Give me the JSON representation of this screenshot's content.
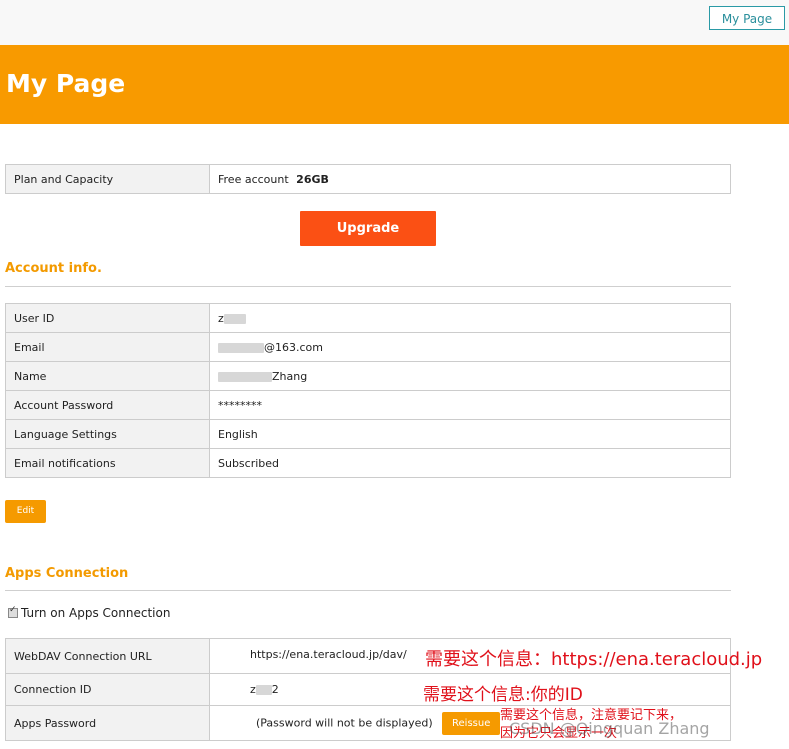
{
  "header": {
    "mypage_button": "My Page",
    "title": "My Page"
  },
  "plan": {
    "label": "Plan and Capacity",
    "value_prefix": "Free account",
    "capacity": "26GB",
    "upgrade_button": "Upgrade"
  },
  "account": {
    "title": "Account info.",
    "rows": [
      {
        "label": "User ID",
        "value": "z"
      },
      {
        "label": "Email",
        "value": "@163.com"
      },
      {
        "label": "Name",
        "value": "Zhang"
      },
      {
        "label": "Account Password",
        "value": "********"
      },
      {
        "label": "Language Settings",
        "value": "English"
      },
      {
        "label": "Email notifications",
        "value": "Subscribed"
      }
    ],
    "edit_button": "Edit"
  },
  "apps": {
    "title": "Apps Connection",
    "toggle_label": "Turn on Apps Connection",
    "rows": [
      {
        "label": "WebDAV Connection URL",
        "value": "https://ena.teracloud.jp/dav/"
      },
      {
        "label": "Connection ID",
        "value": "z",
        "value_suffix": "2"
      },
      {
        "label": "Apps Password",
        "value": "(Password will not be displayed)"
      }
    ],
    "reissue_button": "Reissue"
  },
  "annotations": {
    "url_note": "需要这个信息：https://ena.teracloud.jp",
    "id_note": "需要这个信息:你的ID",
    "password_note_line1": "需要这个信息，注意要记下来，",
    "password_note_line2": "因为它只会显示一次"
  },
  "watermark": "CSDN @Qingquan Zhang",
  "colors": {
    "header_orange": "#f89a00",
    "upgrade_red": "#fb5014",
    "section_orange": "#f39a00",
    "annotation_red": "#e0101a"
  }
}
